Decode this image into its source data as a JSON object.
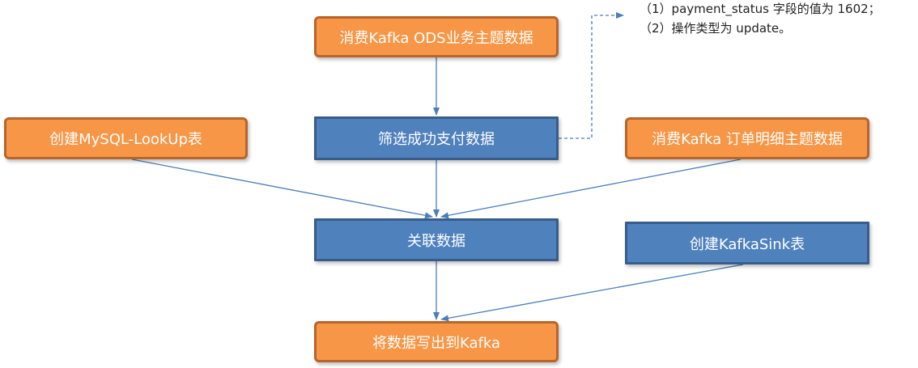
{
  "nodes": {
    "consume_ods": "消费Kafka ODS业务主题数据",
    "filter_paid": "筛选成功支付数据",
    "create_lookup": "创建MySQL-LookUp表",
    "consume_order_detail": "消费Kafka 订单明细主题数据",
    "join": "关联数据",
    "create_sink": "创建KafkaSink表",
    "write_kafka": "将数据写出到Kafka"
  },
  "notes": {
    "line1": "（1）payment_status 字段的值为 1602；",
    "line2": "（2）操作类型为 update。"
  },
  "colors": {
    "orange_fill": "#f79646",
    "orange_border": "#b8652b",
    "blue_fill": "#4f81bd",
    "blue_border": "#385d8a",
    "arrow": "#4a7ebb"
  }
}
